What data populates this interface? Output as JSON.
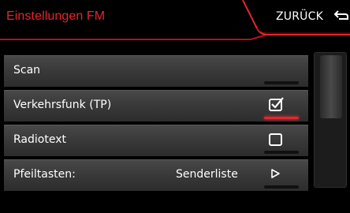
{
  "header": {
    "title": "Einstellungen FM",
    "back_label": "ZURÜCK"
  },
  "menu": {
    "items": [
      {
        "label": "Scan"
      },
      {
        "label": "Verkehrsfunk (TP)",
        "checked": true
      },
      {
        "label": "Radiotext",
        "checked": false
      },
      {
        "label": "Pfeiltasten:",
        "value": "Senderliste"
      }
    ]
  },
  "icons": {
    "back": "back-arrow-icon",
    "checkbox_checked": "checkbox-checked-icon",
    "checkbox_unchecked": "checkbox-unchecked-icon",
    "submenu": "triangle-right-icon"
  },
  "colors": {
    "accent": "#e8242b",
    "background": "#000000"
  }
}
